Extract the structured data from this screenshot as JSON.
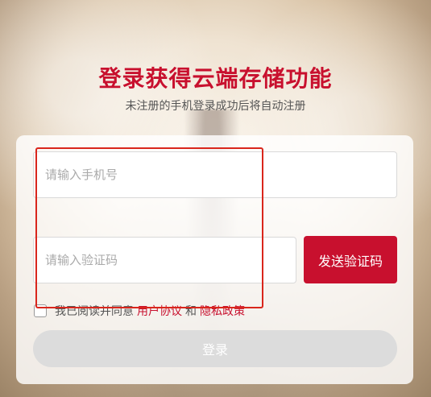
{
  "header": {
    "title": "登录获得云端存储功能",
    "subtitle": "未注册的手机登录成功后将自动注册"
  },
  "form": {
    "phone_placeholder": "请输入手机号",
    "code_placeholder": "请输入验证码",
    "send_code_label": "发送验证码",
    "agree_prefix": "我已阅读并同意",
    "user_agreement": "用户协议",
    "and": "和",
    "privacy_policy": "隐私政策",
    "login_label": "登录"
  },
  "colors": {
    "brand_red": "#c8102e",
    "highlight_border": "#d9261c",
    "disabled_button": "#dcdcdc"
  }
}
